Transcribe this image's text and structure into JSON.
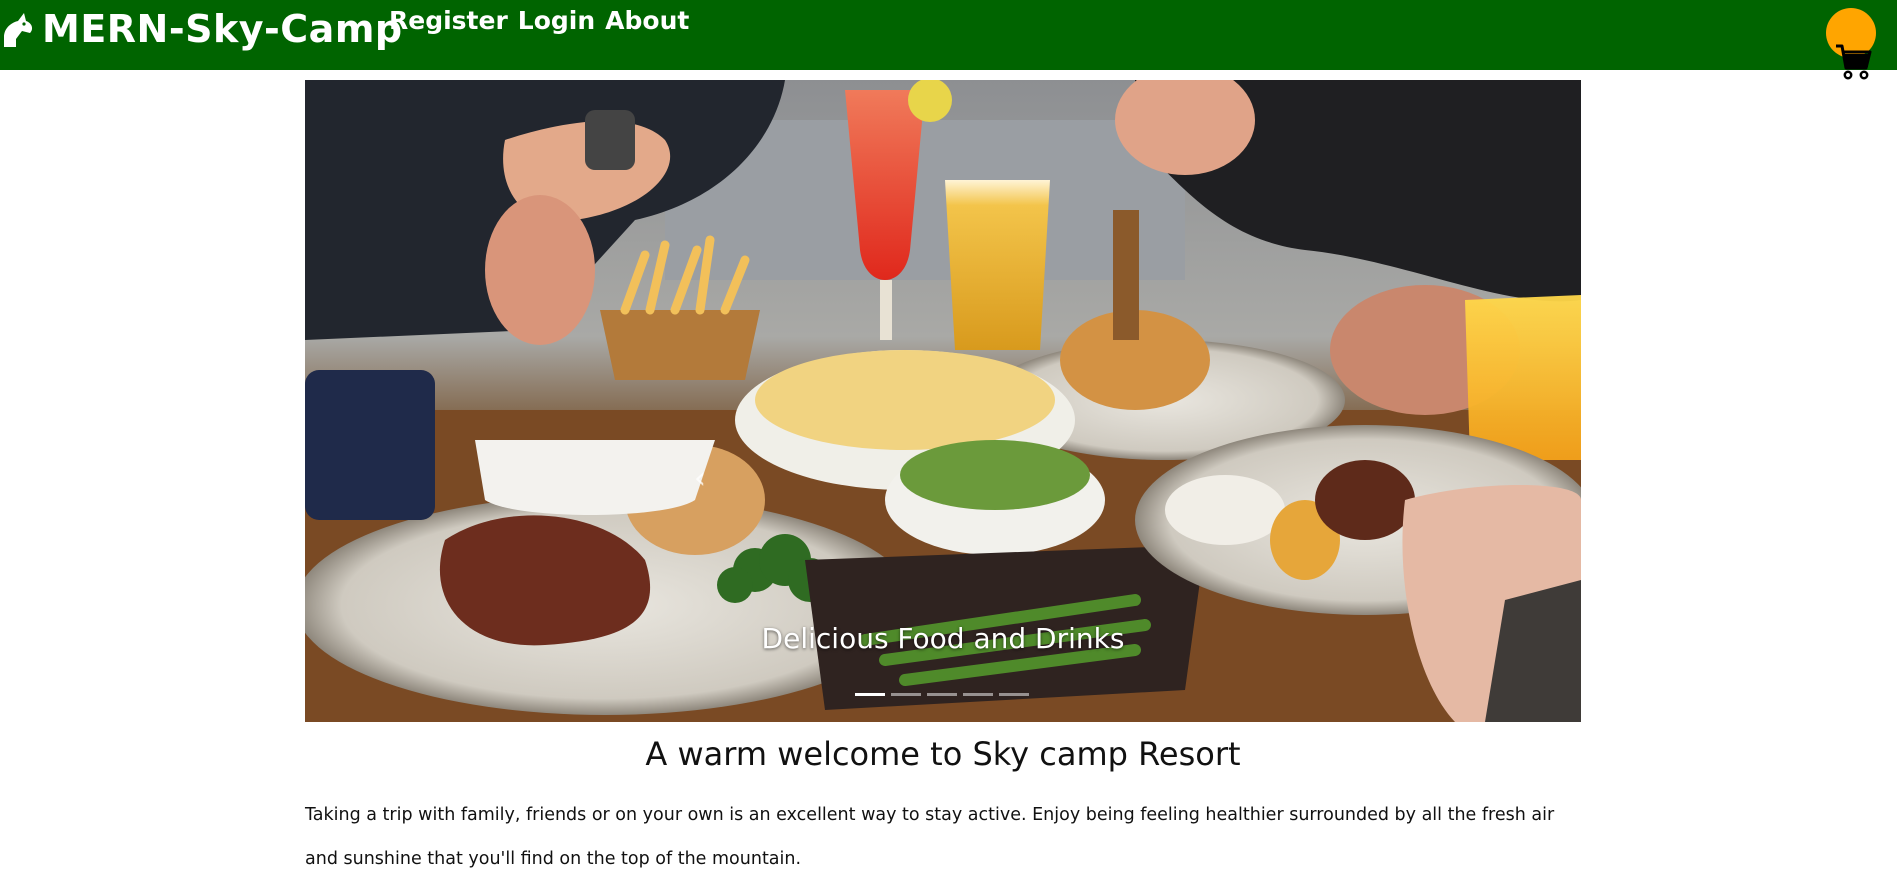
{
  "nav": {
    "brand": "MERN-Sky-Camp",
    "links": [
      "Register",
      "Login",
      "About"
    ],
    "brand_icon": "horse-head-icon",
    "cart_icon": "shopping-cart-icon",
    "colors": {
      "navbar": "#006400",
      "cart_badge": "#ffa500"
    }
  },
  "carousel": {
    "caption": "Delicious Food and Drinks",
    "slide_count": 5,
    "active_slide": 1,
    "prev_icon": "chevron-left-icon",
    "next_icon": "chevron-right-icon"
  },
  "main": {
    "title": "A warm welcome to Sky camp Resort",
    "intro": "Taking a trip with family, friends or on your own is an excellent way to stay active. Enjoy being feeling healthier surrounded by all the fresh air and sunshine that you'll find on the top of the mountain."
  }
}
